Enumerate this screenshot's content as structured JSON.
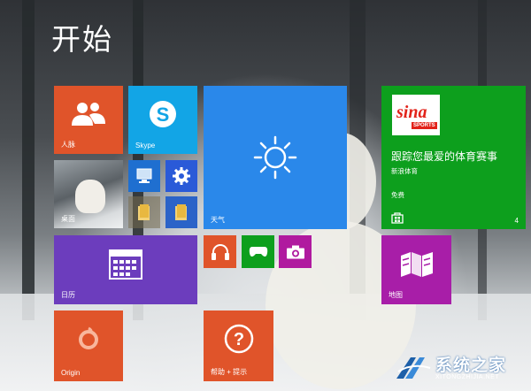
{
  "screen": {
    "title": "开始"
  },
  "tiles": {
    "people": {
      "label": "人脉",
      "color": "#e0542a"
    },
    "skype": {
      "label": "Skype",
      "color": "#12a5e6"
    },
    "weather": {
      "label": "天气",
      "color": "#2a88ea"
    },
    "sina": {
      "headline": "跟踪您最爱的体育赛事",
      "app_name": "新浪体育",
      "price": "免费",
      "count": "4",
      "logo_text": "sina",
      "logo_sub": "SPORTS",
      "color": "#0d9f1d"
    },
    "desktop": {
      "label": "桌面"
    },
    "calendar": {
      "label": "日历",
      "color": "#6c3dbd"
    },
    "maps": {
      "label": "地图",
      "color": "#a81ea8"
    },
    "origin": {
      "label": "Origin",
      "color": "#e0542a"
    },
    "help": {
      "label": "帮助 + 提示",
      "color": "#e0542a"
    },
    "small": {
      "computer": {
        "color": "#1f6fd0"
      },
      "settings": {
        "color": "#2a5ad8"
      },
      "explorer": {
        "color": "#c8a030"
      },
      "explorer2": {
        "color": "#2b63c8"
      },
      "music": {
        "color": "#e0542a"
      },
      "xbox": {
        "color": "#0d9f1d"
      },
      "camera": {
        "color": "#b01a9f"
      }
    }
  },
  "watermark": {
    "name": "系统之家",
    "url": "XITONGZHIJIA.NET"
  }
}
